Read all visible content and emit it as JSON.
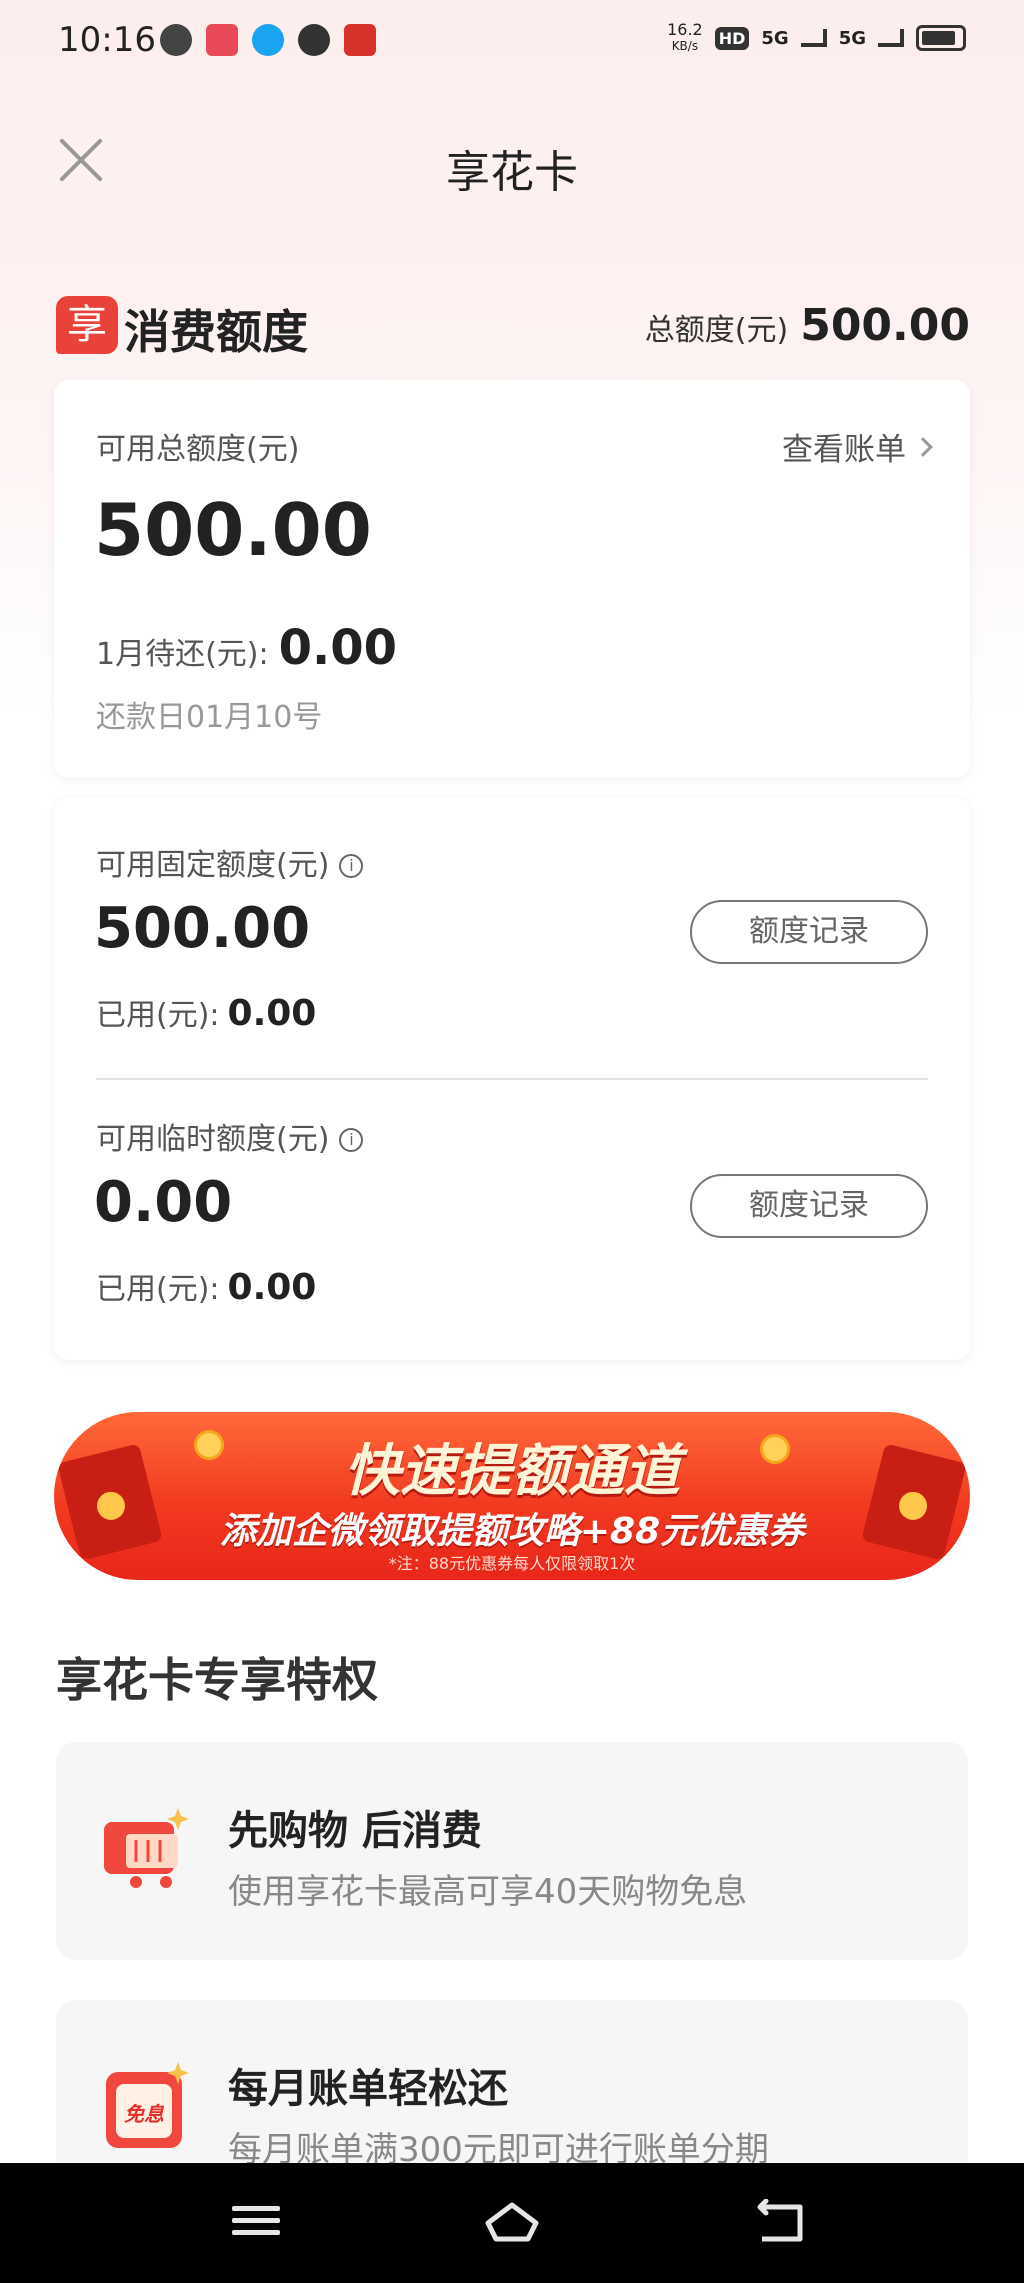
{
  "status_bar": {
    "time": "10:16",
    "speed": "16.2",
    "speed_unit": "KB/s",
    "hd": "HD",
    "net1": "5G",
    "net2": "5G"
  },
  "nav": {
    "title": "享花卡"
  },
  "quota": {
    "logo_char": "享",
    "title": "消费额度",
    "total_label": "总额度(元)",
    "total_value": "500.00"
  },
  "available": {
    "label": "可用总额度(元)",
    "value": "500.00",
    "bill_link": "查看账单",
    "due_label": "1月待还(元):",
    "due_value": "0.00",
    "repay_day": "还款日01月10号"
  },
  "fixed": {
    "label": "可用固定额度(元)",
    "value": "500.00",
    "record_btn": "额度记录",
    "used_label": "已用(元):",
    "used_value": "0.00"
  },
  "temporary": {
    "label": "可用临时额度(元)",
    "value": "0.00",
    "record_btn": "额度记录",
    "used_label": "已用(元):",
    "used_value": "0.00"
  },
  "banner": {
    "headline": "快速提额通道",
    "subline": "添加企微领取提额攻略+88元优惠券",
    "note": "*注：88元优惠券每人仅限领取1次"
  },
  "privileges": {
    "title": "享花卡专享特权",
    "items": [
      {
        "title": "先购物 后消费",
        "desc": "使用享花卡最高可享40天购物免息",
        "icon": "cart-icon"
      },
      {
        "title": "每月账单轻松还",
        "desc": "每月账单满300元即可进行账单分期",
        "icon": "interest-free-icon",
        "icon_text": "免息"
      }
    ]
  }
}
